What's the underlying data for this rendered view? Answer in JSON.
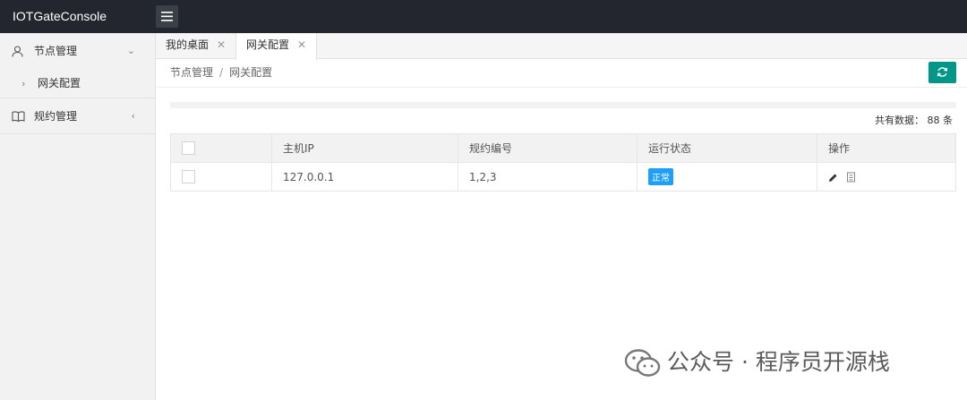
{
  "app": {
    "title": "IOTGateConsole"
  },
  "sidebar": {
    "items": [
      {
        "label": "节点管理",
        "icon": "user-icon",
        "arrow": "⌄",
        "children": [
          {
            "label": "网关配置"
          }
        ]
      },
      {
        "label": "规约管理",
        "icon": "book-icon",
        "arrow": "‹"
      }
    ]
  },
  "tabs": [
    {
      "label": "我的桌面",
      "close": "✕"
    },
    {
      "label": "网关配置",
      "close": "✕",
      "active": true
    }
  ],
  "breadcrumb": {
    "parent": "节点管理",
    "separator": "/",
    "current": "网关配置"
  },
  "total": {
    "label": "共有数据：",
    "count": "88",
    "unit": "条"
  },
  "table": {
    "headers": [
      "",
      "主机IP",
      "规约编号",
      "运行状态",
      "操作"
    ],
    "rows": [
      {
        "ip": "127.0.0.1",
        "protocol": "1,2,3",
        "status": "正常"
      }
    ]
  },
  "watermark": {
    "text": "公众号 · 程序员开源栈"
  },
  "colors": {
    "topbar": "#23262e",
    "accent": "#009688",
    "status": "#1e9fff"
  }
}
